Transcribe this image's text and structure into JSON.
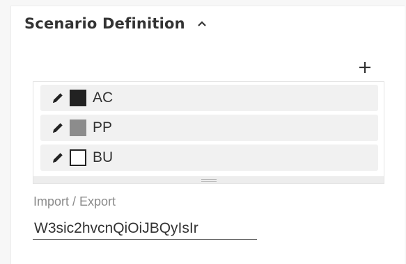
{
  "section": {
    "title": "Scenario Definition",
    "toggle_icon": "chevron-up-icon"
  },
  "toolbar": {
    "add_icon": "plus-icon"
  },
  "scenarios": [
    {
      "label": "AC",
      "edit_icon": "pencil-icon",
      "swatch_color": "#222222",
      "swatch_border": "#222222"
    },
    {
      "label": "PP",
      "edit_icon": "pencil-icon",
      "swatch_color": "#8c8c8c",
      "swatch_border": "#8c8c8c"
    },
    {
      "label": "BU",
      "edit_icon": "pencil-icon",
      "swatch_color": "#ffffff",
      "swatch_border": "#222222"
    }
  ],
  "import_export": {
    "label": "Import / Export",
    "value": "W3sic2hvcnQiOiJBQyIsIr"
  }
}
